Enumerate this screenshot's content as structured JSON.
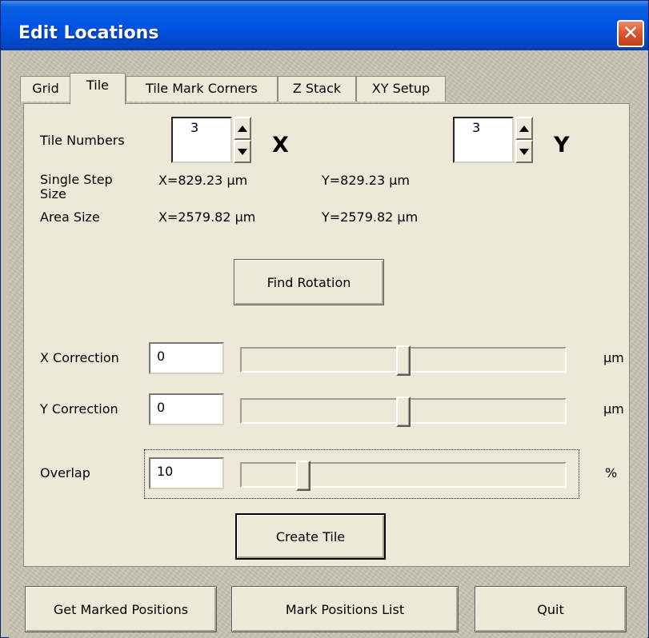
{
  "window": {
    "title": "Edit Locations",
    "close_glyph": "✕"
  },
  "tabs": [
    {
      "label": "Grid"
    },
    {
      "label": "Tile",
      "active": true
    },
    {
      "label": "Tile Mark Corners"
    },
    {
      "label": "Z Stack"
    },
    {
      "label": "XY Setup"
    }
  ],
  "tile": {
    "tile_numbers_label": "Tile Numbers",
    "x_value": "3",
    "y_value": "3",
    "x_axis": "X",
    "y_axis": "Y",
    "single_step_label": "Single Step Size",
    "single_step_x": "X=829.23 µm",
    "single_step_y": "Y=829.23 µm",
    "area_size_label": "Area Size",
    "area_x": "X=2579.82 µm",
    "area_y": "Y=2579.82 µm",
    "find_rotation_label": "Find Rotation",
    "x_correction_label": "X Correction",
    "x_correction_value": "0",
    "x_correction_slider": 0.5,
    "x_correction_unit": "µm",
    "y_correction_label": "Y Correction",
    "y_correction_value": "0",
    "y_correction_slider": 0.5,
    "y_correction_unit": "µm",
    "overlap_label": "Overlap",
    "overlap_value": "10",
    "overlap_slider": 0.19,
    "overlap_unit": "%",
    "create_tile_label": "Create Tile"
  },
  "footer": {
    "get_marked_label": "Get Marked Positions",
    "mark_list_label": "Mark Positions List",
    "quit_label": "Quit"
  },
  "colors": {
    "title_bar": "#0054e3",
    "close_button": "#d9542d",
    "dialog_face": "#ece9d8",
    "frame_texture": "#c9c4b3"
  },
  "icons": {
    "close": "close-icon",
    "spin_up": "arrow-up-icon",
    "spin_down": "arrow-down-icon"
  }
}
